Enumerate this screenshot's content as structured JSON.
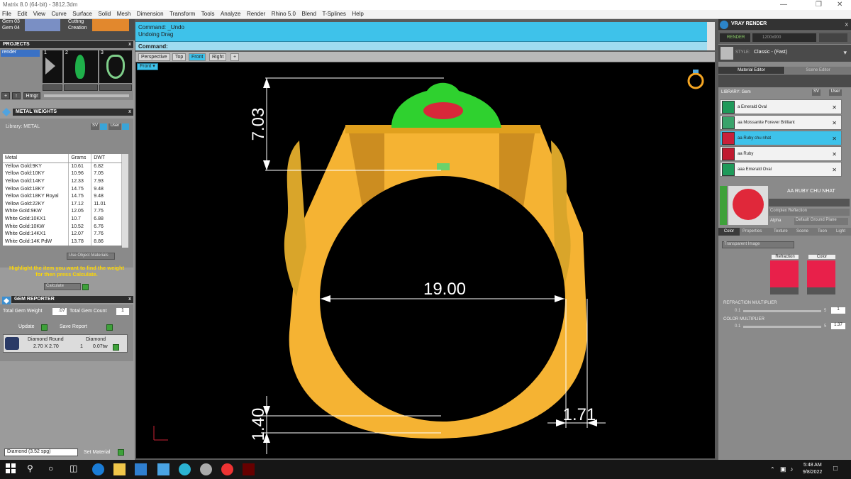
{
  "window": {
    "title": "Matrix 8.0 (64-bit) - 3812.3dm"
  },
  "menu": [
    "File",
    "Edit",
    "View",
    "Curve",
    "Surface",
    "Solid",
    "Mesh",
    "Dimension",
    "Transform",
    "Tools",
    "Analyze",
    "Render",
    "Rhino 5.0",
    "Blend",
    "T-Splines",
    "Help"
  ],
  "toolbar": {
    "gem03": "Gem 03",
    "gem04": "Gem 04",
    "cutting": "Cutting",
    "creation": "Creation"
  },
  "projects": {
    "title": "PROJECTS",
    "item": "render",
    "thumbs": [
      "1",
      "2",
      "3"
    ],
    "hmgr": "Hmgr"
  },
  "metal": {
    "title": "METAL WEIGHTS",
    "library_label": "Library: METAL",
    "sv": "SV",
    "user": "User",
    "headers": [
      "Metal",
      "Grams",
      "DWT"
    ],
    "rows": [
      [
        "Yellow Gold:9KY",
        "10.61",
        "6.82"
      ],
      [
        "Yellow Gold:10KY",
        "10.96",
        "7.05"
      ],
      [
        "Yellow Gold:14KY",
        "12.33",
        "7.93"
      ],
      [
        "Yellow Gold:18KY",
        "14.75",
        "9.48"
      ],
      [
        "Yellow Gold:18KY Royal",
        "14.75",
        "9.48"
      ],
      [
        "Yellow Gold:22KY",
        "17.12",
        "11.01"
      ],
      [
        "White Gold:9KW",
        "12.05",
        "7.75"
      ],
      [
        "White Gold:10KX1",
        "10.7",
        "6.88"
      ],
      [
        "White Gold:10KW",
        "10.52",
        "6.76"
      ],
      [
        "White Gold:14KX1",
        "12.07",
        "7.76"
      ],
      [
        "White Gold:14K PdW",
        "13.78",
        "8.86"
      ]
    ],
    "use_object_materials": "Use Object Materials",
    "hint": "Highlight the item you want to find the weight for then press Calculate.",
    "calculate": "Calculate"
  },
  "gem": {
    "title": "GEM REPORTER",
    "total_weight_label": "Total Gem Weight",
    "total_weight": ".07",
    "total_count_label": "Total Gem Count",
    "total_count": "1",
    "update": "Update",
    "save_report": "Save Report",
    "row": {
      "name": "Diamond Round",
      "size": "2.70 X 2.70",
      "type": "Diamond",
      "count": "1",
      "tw": "0.07tw"
    }
  },
  "bottom_left": {
    "material_select": "Diamond  (3.52 spg)",
    "set_material": "Set Material"
  },
  "command": {
    "line1": "Command: _Undo",
    "line2": "Undoing Drag",
    "prompt": "Command:"
  },
  "views": {
    "tabs": [
      "Perspective",
      "Top",
      "Front",
      "Right"
    ],
    "active_view": "Front"
  },
  "dimensions": {
    "height": "7.03",
    "diameter": "19.00",
    "thickness": "1.40",
    "width": "1.71"
  },
  "vray": {
    "title": "VRAY RENDER",
    "render": "RENDER",
    "resolution": "1200x900",
    "style_label": "STYLE:",
    "style": "Classic - (Fast)",
    "tabs": [
      "Material Editor",
      "Scene Editor"
    ],
    "library": "LIBRARY: Gem",
    "sv": "SV",
    "user": "User",
    "materials": [
      {
        "name": "a Emerald Oval",
        "color": "#1f9a5a"
      },
      {
        "name": "aa Moissanite Forever Brilliant",
        "color": "#3aa36b"
      },
      {
        "name": "aa Ruby chu nhat",
        "color": "#c9203a"
      },
      {
        "name": "aa Ruby",
        "color": "#c01a30"
      },
      {
        "name": "aaa Emerald Oval",
        "color": "#1f9a5a"
      }
    ],
    "selected_material": "AA RUBY CHU NHAT",
    "complex": "Complex Reflection",
    "alpha": "Alpha",
    "ground": "Default Ground Plane",
    "subtabs": [
      "Color",
      "Properties",
      "Texture",
      "Scene",
      "Toon",
      "Light"
    ],
    "transparent": "Transparent Image",
    "refraction": "Refraction",
    "color": "Color",
    "refr_mult": "REFRACTION MULTIPLIER",
    "refr_min": "0.1",
    "refr_max": "5",
    "refr_val": "1",
    "color_mult": "COLOR MULTIPLIER",
    "color_min": "0.1",
    "color_max": "5",
    "color_val": "1.37"
  },
  "taskbar": {
    "time": "5:48 AM",
    "date": "9/8/2022"
  },
  "colors": {
    "cmd_bg": "#3ec2ea",
    "gold": "#f5b333",
    "gem_green": "#2fd12f",
    "ruby": "#d8283a",
    "vray_sel": "#3ec2ea"
  }
}
